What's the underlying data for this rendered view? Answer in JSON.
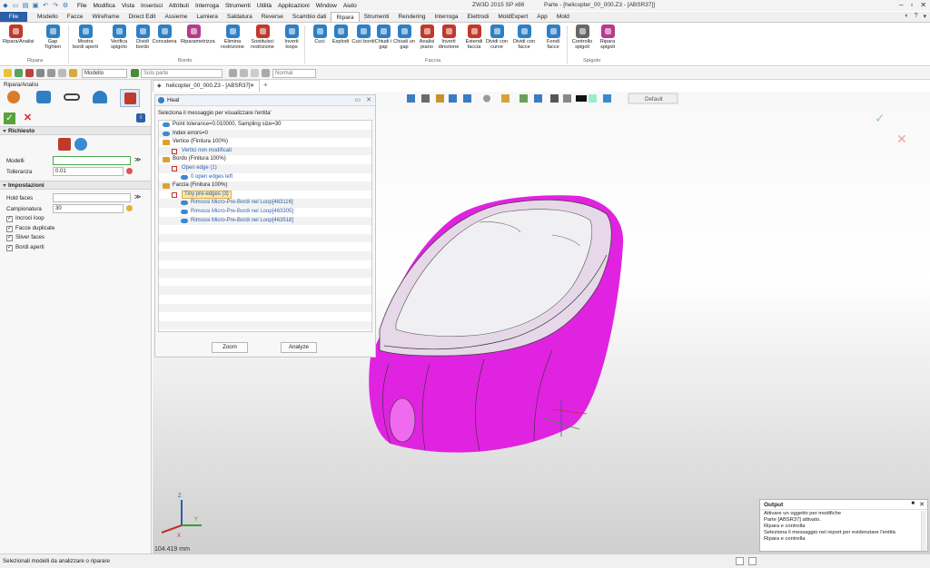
{
  "app": {
    "title": "ZW3D 2015 SP x86",
    "document": "Parte - [helicopter_00_000.Z3 - [ABSR37]]"
  },
  "menu": [
    "File",
    "Modifica",
    "Vista",
    "Inserisci",
    "Attributi",
    "Interroga",
    "Strumenti",
    "Utilità",
    "Applicazioni",
    "Window",
    "Aiuto"
  ],
  "tabs": [
    "File",
    "Modello",
    "Facce",
    "Wireframe",
    "Direct Edit",
    "Assieme",
    "Lamiera",
    "Saldatura",
    "Reverse",
    "Scambio dati",
    "Ripara",
    "Strumenti",
    "Rendering",
    "Interroga",
    "Elettrodi",
    "MoldExpert",
    "App",
    "Mold"
  ],
  "active_tab": "Ripara",
  "ribbon": {
    "buttons": [
      {
        "label": "Ripara/Analisi",
        "color": "#c0392b"
      },
      {
        "label": "Gap Tighten",
        "color": "#2e7fc4"
      },
      {
        "label": "Mostra bordi aperti",
        "color": "#2e7fc4"
      },
      {
        "label": "Verifica spigolo",
        "color": "#2e7fc4"
      },
      {
        "label": "Dividi bordo",
        "color": "#2e7fc4"
      },
      {
        "label": "Concatena",
        "color": "#2e7fc4"
      },
      {
        "label": "Riparametrizza",
        "color": "#b83a8c"
      },
      {
        "label": "Elimina restrizione",
        "color": "#2e7fc4"
      },
      {
        "label": "Sostituisci restrizione",
        "color": "#c0392b"
      },
      {
        "label": "Inverti loops",
        "color": "#2e7fc4"
      },
      {
        "label": "Cuci",
        "color": "#2e7fc4"
      },
      {
        "label": "Esplodi",
        "color": "#2e7fc4"
      },
      {
        "label": "Cuci bordi",
        "color": "#2e7fc4"
      },
      {
        "label": "Chiudi i gap",
        "color": "#2e7fc4"
      },
      {
        "label": "Chiudi un gap",
        "color": "#2e7fc4"
      },
      {
        "label": "Analisi piano",
        "color": "#c0392b"
      },
      {
        "label": "Inverti direzione",
        "color": "#c0392b"
      },
      {
        "label": "Estendi faccia",
        "color": "#c0392b"
      },
      {
        "label": "Dividi con curve",
        "color": "#2e7fc4"
      },
      {
        "label": "Dividi con facce",
        "color": "#2e7fc4"
      },
      {
        "label": "Fondi facce",
        "color": "#2e7fc4"
      },
      {
        "label": "Controllo spigoli",
        "color": "#666666"
      },
      {
        "label": "Ripara spigoli",
        "color": "#b83a8c"
      }
    ],
    "groups": [
      "Ripara",
      "Bordo",
      "Faccia",
      "Spigolo"
    ]
  },
  "toolbar": {
    "mode": "Modello",
    "filter": "Solo parte",
    "render": "Normal",
    "view": "Default"
  },
  "left_panel": {
    "title": "Ripara/Analisi",
    "section_required": "Richiesto",
    "models_label": "Modelli",
    "models_value": "",
    "tolerance_label": "Tolleranza",
    "tolerance_value": "0.01",
    "section_settings": "Impostazioni",
    "hold_faces_label": "Hold faces",
    "hold_faces_value": "",
    "sampling_label": "Campionatura",
    "sampling_value": "30",
    "checks": [
      {
        "label": "Incroci loop",
        "checked": true
      },
      {
        "label": "Facce duplicate",
        "checked": true
      },
      {
        "label": "Sliver faces",
        "checked": true
      },
      {
        "label": "Bordi aperti",
        "checked": true
      }
    ]
  },
  "doc_tab": "helicopter_00_000.Z3 - [ABSR37]",
  "heal": {
    "title": "Heal",
    "instruction": "Seleziona il messaggio per visualizzare l'entita'",
    "rows": [
      {
        "text": "Point tolerance=0.010000, Sampling size=30",
        "indent": 0,
        "icon": "info"
      },
      {
        "text": "Index errors=0",
        "indent": 0,
        "icon": "info"
      },
      {
        "text": "Vertice (Finitura 100%)",
        "indent": 0,
        "icon": "folder"
      },
      {
        "text": "Vertici non modificati",
        "indent": 1,
        "icon": "box"
      },
      {
        "text": "Bordo (Finitura 100%)",
        "indent": 0,
        "icon": "folder"
      },
      {
        "text": "Open edge (1)",
        "indent": 1,
        "icon": "box"
      },
      {
        "text": "0 open edges left",
        "indent": 2,
        "icon": "info"
      },
      {
        "text": "Faccia (Finitura 100%)",
        "indent": 0,
        "icon": "folder"
      },
      {
        "text": "Tiny pre-edges (3)",
        "indent": 1,
        "icon": "box"
      },
      {
        "text": "Rimossi Micro-Pre-Bordi nel Loop[463116]",
        "indent": 2,
        "icon": "info"
      },
      {
        "text": "Rimossi Micro-Pre-Bordi nel Loop[463305]",
        "indent": 2,
        "icon": "info"
      },
      {
        "text": "Rimossi Micro-Pre-Bordi nel Loop[463518]",
        "indent": 2,
        "icon": "info"
      }
    ],
    "zoom_label": "Zoom",
    "analyze_label": "Analyze"
  },
  "scale_readout": "104.419 mm",
  "output": {
    "title": "Output",
    "lines": [
      "Attivare un oggetto per modifiche",
      "Parte [ABSR37] attivato.",
      "Ripara e controlla",
      "Seleziona il messaggio nel report per evidenziare l'entità",
      "Ripara e controlla"
    ]
  },
  "status": "Selezionali modelli da analizzare o riparare",
  "colors": {
    "accent": "#2b5fa8",
    "model": "#e023e0"
  }
}
